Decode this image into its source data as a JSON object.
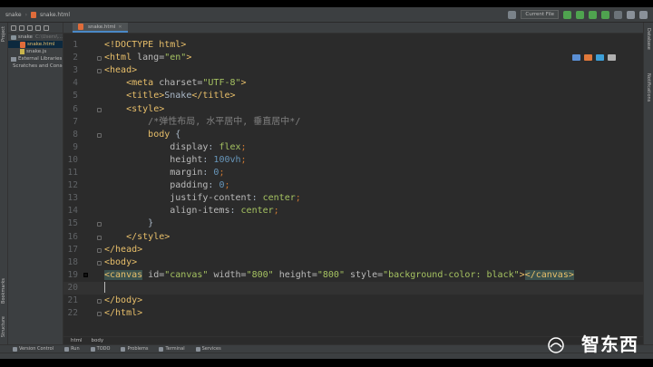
{
  "toolbar": {
    "project_name": "snake",
    "file_name": "snake.html",
    "run_config": "Current File"
  },
  "left_strip": {
    "project_label": "Project",
    "bookmarks_label": "Bookmarks",
    "structure_label": "Structure"
  },
  "right_strip": {
    "database_label": "Database",
    "notifications_label": "Notifications"
  },
  "project_tree": [
    {
      "label": "snake",
      "suffix": "C:\\Users\\...",
      "kind": "folder",
      "indent": 0
    },
    {
      "label": "snake.html",
      "kind": "html",
      "indent": 1,
      "selected": true
    },
    {
      "label": "snake.js",
      "kind": "js",
      "indent": 1
    },
    {
      "label": "External Libraries",
      "kind": "lib",
      "indent": 0
    },
    {
      "label": "Scratches and Consoles",
      "kind": "lib",
      "indent": 0
    }
  ],
  "editor": {
    "tab_label": "snake.html",
    "current_line": 20,
    "lines": [
      {
        "n": "1",
        "html": "<span class='tag'>&lt;!DOCTYPE html&gt;</span>"
      },
      {
        "n": "2",
        "html": "<span class='tag'>&lt;html </span><span class='attr'>lang=</span><span class='str'>\"en\"</span><span class='tag'>&gt;</span>"
      },
      {
        "n": "3",
        "html": "<span class='tag'>&lt;head&gt;</span>"
      },
      {
        "n": "4",
        "html": "    <span class='tag'>&lt;meta </span><span class='attr'>charset=</span><span class='str'>\"UTF-8\"</span><span class='tag'>&gt;</span>"
      },
      {
        "n": "5",
        "html": "    <span class='tag'>&lt;title&gt;</span><span class='txtc'>Snake</span><span class='tag'>&lt;/title&gt;</span>"
      },
      {
        "n": "6",
        "html": "    <span class='tag'>&lt;style&gt;</span>"
      },
      {
        "n": "7",
        "html": "        <span class='cmt'>/*弹性布局, 水平居中, 垂直居中*/</span>"
      },
      {
        "n": "8",
        "html": "        <span class='sel'>body</span> <span class='txtc'>{</span>"
      },
      {
        "n": "9",
        "html": "            <span class='prop'>display</span><span class='txtc'>: </span><span class='val'>flex</span><span class='kw'>;</span>"
      },
      {
        "n": "10",
        "html": "            <span class='prop'>height</span><span class='txtc'>: </span><span class='num'>100vh</span><span class='kw'>;</span>"
      },
      {
        "n": "11",
        "html": "            <span class='prop'>margin</span><span class='txtc'>: </span><span class='num'>0</span><span class='kw'>;</span>"
      },
      {
        "n": "12",
        "html": "            <span class='prop'>padding</span><span class='txtc'>: </span><span class='num'>0</span><span class='kw'>;</span>"
      },
      {
        "n": "13",
        "html": "            <span class='prop'>justify-content</span><span class='txtc'>: </span><span class='val'>center</span><span class='kw'>;</span>"
      },
      {
        "n": "14",
        "html": "            <span class='prop'>align-items</span><span class='txtc'>: </span><span class='val'>center</span><span class='kw'>;</span>"
      },
      {
        "n": "15",
        "html": "        <span class='txtc'>}</span>"
      },
      {
        "n": "16",
        "html": "    <span class='tag'>&lt;/style&gt;</span>"
      },
      {
        "n": "17",
        "html": "<span class='tag'>&lt;/head&gt;</span>"
      },
      {
        "n": "18",
        "html": "<span class='tag'>&lt;body&gt;</span>"
      },
      {
        "n": "19",
        "html": "<span class='tag hl'>&lt;canvas</span><span class='attr'> id=</span><span class='str'>\"canvas\"</span><span class='attr'> width=</span><span class='str'>\"800\"</span><span class='attr'> height=</span><span class='str'>\"800\"</span><span class='attr'> style=</span><span class='str'>\"background-color: black\"</span><span class='tag'>&gt;</span><span class='tag hl'>&lt;/canvas&gt;</span>"
      },
      {
        "n": "20",
        "html": "<span class='caret'></span>"
      },
      {
        "n": "21",
        "html": "<span class='tag'>&lt;/body&gt;</span>"
      },
      {
        "n": "22",
        "html": "<span class='tag'>&lt;/html&gt;</span>"
      }
    ],
    "crumb": [
      "html",
      "body"
    ]
  },
  "bottom_tabs": [
    {
      "label": "Version Control"
    },
    {
      "label": "Run"
    },
    {
      "label": "TODO"
    },
    {
      "label": "Problems"
    },
    {
      "label": "Terminal"
    },
    {
      "label": "Services"
    }
  ],
  "watermark": "智东西",
  "colors": {
    "background": "#2b2b2b",
    "panel": "#3c3f41",
    "tag": "#e8bf6a",
    "string": "#a5c261",
    "number": "#6897bb",
    "comment": "#808080"
  }
}
